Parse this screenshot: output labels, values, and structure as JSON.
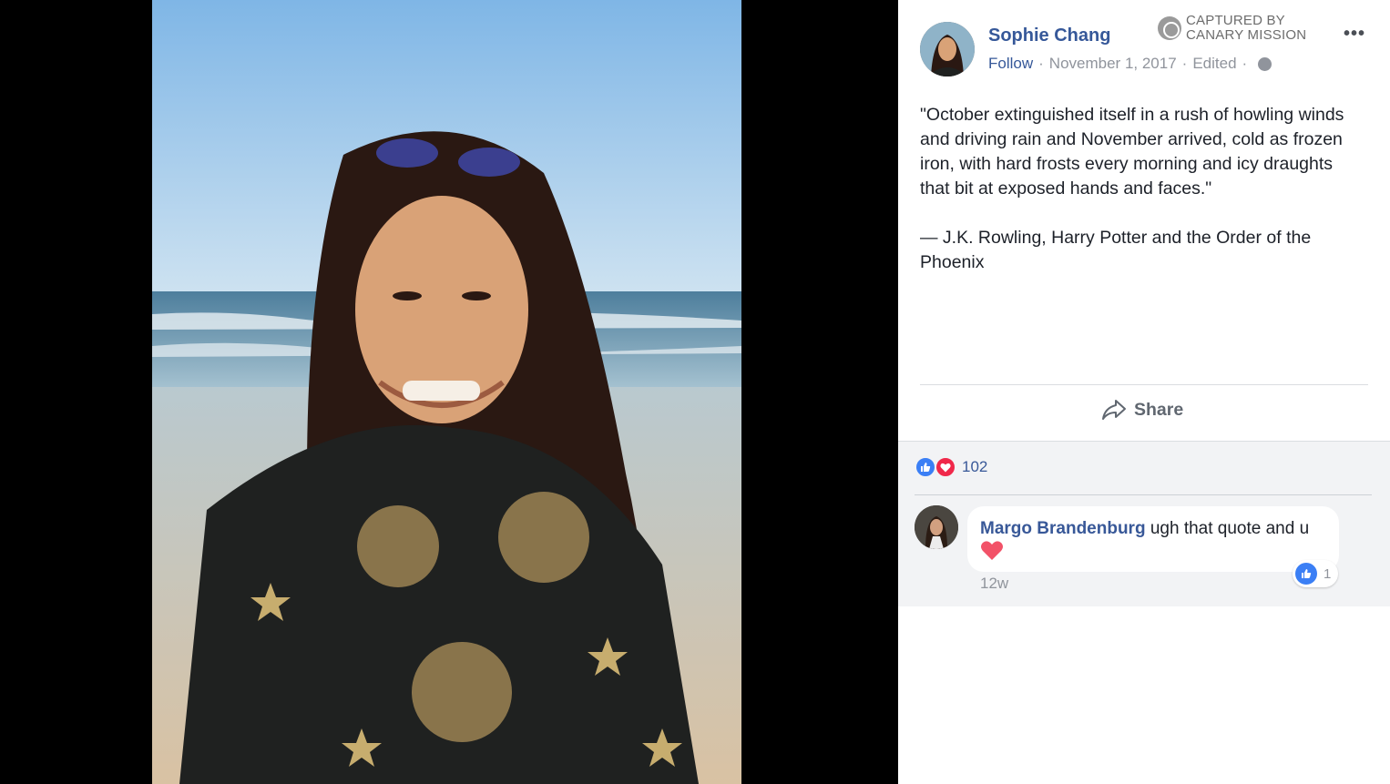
{
  "post": {
    "author": "Sophie Chang",
    "follow_label": "Follow",
    "date": "November 1, 2017",
    "edited": "Edited",
    "separator": "·",
    "more_label": "•••",
    "quote": "\"October extinguished itself in a rush of howling winds and driving rain and November arrived, cold as frozen iron, with hard frosts every morning and icy draughts that bit at exposed hands and faces.\"",
    "attribution": "— J.K. Rowling, Harry Potter and the Order of the Phoenix"
  },
  "watermark": {
    "line1": "CAPTURED BY",
    "line2": "CANARY MISSION"
  },
  "actions": {
    "share_label": "Share"
  },
  "reactions": {
    "count": "102",
    "icons": [
      "like-icon",
      "love-icon"
    ]
  },
  "comment": {
    "author": "Margo Brandenburg",
    "text": "ugh that quote and u",
    "time": "12w",
    "like_count": "1"
  },
  "colors": {
    "link_blue": "#365899",
    "like_blue": "#3b7ff5",
    "love_red": "#f0284a",
    "muted": "#90949c"
  }
}
